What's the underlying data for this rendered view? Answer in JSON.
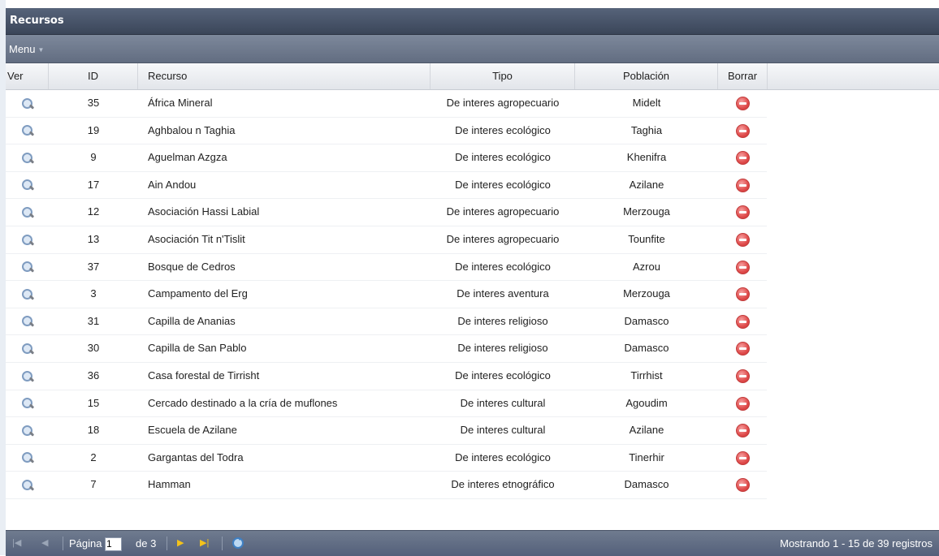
{
  "panel": {
    "title": "Recursos"
  },
  "menu": {
    "label": "Menu"
  },
  "columns": {
    "ver": "Ver",
    "id": "ID",
    "recurso": "Recurso",
    "tipo": "Tipo",
    "poblacion": "Población",
    "borrar": "Borrar"
  },
  "rows": [
    {
      "id": "35",
      "recurso": "África Mineral",
      "tipo": "De interes agropecuario",
      "poblacion": "Midelt"
    },
    {
      "id": "19",
      "recurso": "Aghbalou n Taghia",
      "tipo": "De interes ecológico",
      "poblacion": "Taghia"
    },
    {
      "id": "9",
      "recurso": "Aguelman Azgza",
      "tipo": "De interes ecológico",
      "poblacion": "Khenifra"
    },
    {
      "id": "17",
      "recurso": "Ain Andou",
      "tipo": "De interes ecológico",
      "poblacion": "Azilane"
    },
    {
      "id": "12",
      "recurso": "Asociación Hassi Labial",
      "tipo": "De interes agropecuario",
      "poblacion": "Merzouga"
    },
    {
      "id": "13",
      "recurso": "Asociación Tit n'Tislit",
      "tipo": "De interes agropecuario",
      "poblacion": "Tounfite"
    },
    {
      "id": "37",
      "recurso": "Bosque de Cedros",
      "tipo": "De interes ecológico",
      "poblacion": "Azrou"
    },
    {
      "id": "3",
      "recurso": "Campamento del Erg",
      "tipo": "De interes aventura",
      "poblacion": "Merzouga"
    },
    {
      "id": "31",
      "recurso": "Capilla de Ananias",
      "tipo": "De interes religioso",
      "poblacion": "Damasco"
    },
    {
      "id": "30",
      "recurso": "Capilla de San Pablo",
      "tipo": "De interes religioso",
      "poblacion": "Damasco"
    },
    {
      "id": "36",
      "recurso": "Casa forestal de Tirrisht",
      "tipo": "De interes ecológico",
      "poblacion": "Tirrhist"
    },
    {
      "id": "15",
      "recurso": "Cercado destinado a la cría de muflones",
      "tipo": "De interes cultural",
      "poblacion": "Agoudim"
    },
    {
      "id": "18",
      "recurso": "Escuela de Azilane",
      "tipo": "De interes cultural",
      "poblacion": "Azilane"
    },
    {
      "id": "2",
      "recurso": "Gargantas del Todra",
      "tipo": "De interes ecológico",
      "poblacion": "Tinerhir"
    },
    {
      "id": "7",
      "recurso": "Hamman",
      "tipo": "De interes etnográfico",
      "poblacion": "Damasco"
    }
  ],
  "pager": {
    "pagina_label": "Página",
    "current_page": "1",
    "de_label": "de 3",
    "status": "Mostrando 1 - 15 de 39 registros"
  },
  "icons": {
    "view": "magnifier-icon",
    "delete": "delete-icon",
    "first": "first-page-icon",
    "prev": "prev-page-icon",
    "next": "next-page-icon",
    "last": "last-page-icon",
    "refresh": "refresh-icon"
  }
}
